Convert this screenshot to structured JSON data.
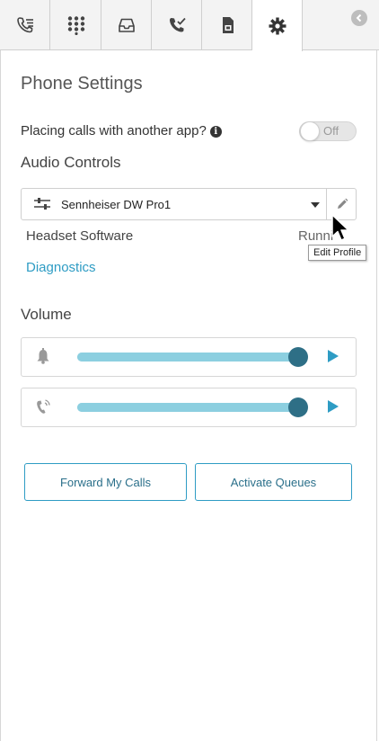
{
  "tabs": [
    {
      "icon": "call-list-icon"
    },
    {
      "icon": "dialpad-icon"
    },
    {
      "icon": "inbox-icon"
    },
    {
      "icon": "call-check-icon"
    },
    {
      "icon": "sim-card-icon"
    },
    {
      "icon": "gear-icon",
      "active": true
    }
  ],
  "header": {
    "title": "Phone Settings"
  },
  "placing_calls": {
    "label": "Placing calls with another app?",
    "info_icon": "i",
    "toggle_label": "Off",
    "toggle_on": false
  },
  "audio_controls": {
    "heading": "Audio Controls",
    "device": "Sennheiser DW Pro1",
    "headset_software_label": "Headset Software",
    "headset_software_status": "Running",
    "diagnostics_label": "Diagnostics",
    "edit_tooltip": "Edit Profile"
  },
  "volume": {
    "heading": "Volume",
    "ringer_level": 0.99,
    "speaker_level": 0.99
  },
  "actions": {
    "forward_label": "Forward My Calls",
    "queues_label": "Activate Queues"
  },
  "colors": {
    "accent": "#2e9cc4",
    "slider_track": "#a3d6e3",
    "slider_knob": "#2e6f86"
  }
}
